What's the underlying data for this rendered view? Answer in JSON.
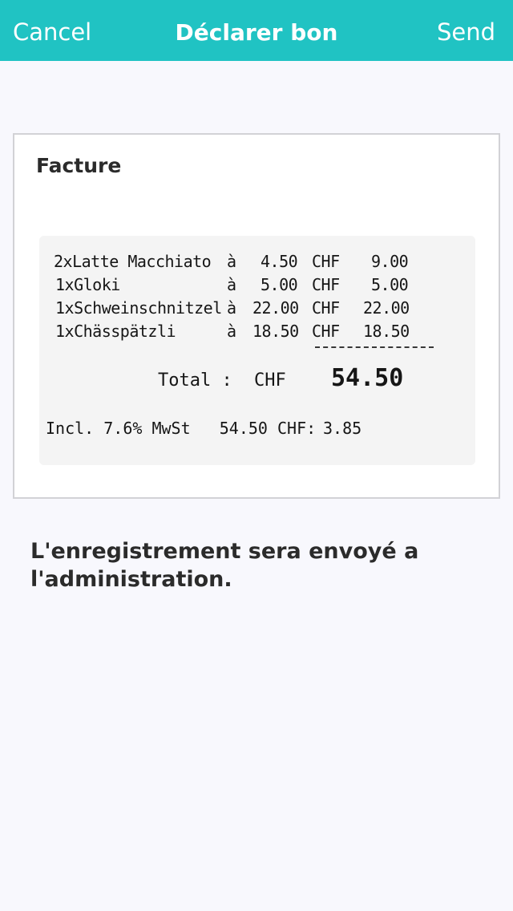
{
  "navbar": {
    "cancel_label": "Cancel",
    "title": "Déclarer bon",
    "send_label": "Send",
    "background_color": "#20c3c3"
  },
  "card": {
    "title": "Facture",
    "receipt": {
      "items": [
        {
          "name": "2xLatte Macchiato",
          "at": "à",
          "unit_price": "4.50",
          "currency": "CHF",
          "total": "9.00"
        },
        {
          "name": "1xGloki",
          "at": "à",
          "unit_price": "5.00",
          "currency": "CHF",
          "total": "5.00"
        },
        {
          "name": "1xSchweinschnitzel",
          "at": "à",
          "unit_price": "22.00",
          "currency": "CHF",
          "total": "22.00"
        },
        {
          "name": "1xChässpätzli",
          "at": "à",
          "unit_price": "18.50",
          "currency": "CHF",
          "total": "18.50"
        }
      ],
      "total_label": "Total :",
      "total_currency": "CHF",
      "total_value": "54.50",
      "tax_line": "Incl. 7.6% MwSt   54.50 CHF:",
      "tax_amount": "3.85"
    }
  },
  "message": "L'enregistrement sera envoyé a l'administration."
}
